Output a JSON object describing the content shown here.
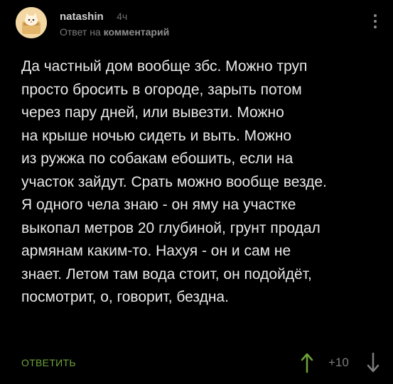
{
  "comment": {
    "author": "natashin",
    "time": "4ч",
    "reply_prefix": "Ответ на",
    "reply_link": "комментарий",
    "lines": [
      "Да частный дом вообще збс. Можно труп",
      "просто бросить в огороде, зарыть потом",
      "через пару дней, или вывезти. Можно",
      "на крыше ночью сидеть и выть. Можно",
      "из ружжа по собакам ебошить, если на",
      "участок зайдут. Срать можно вообще везде.",
      "Я одного чела знаю - он яму на участке",
      "выкопал метров 20 глубиной, грунт продал",
      "армянам каким-то. Нахуя - он и сам не",
      "знает. Летом там вода стоит, он подойдёт,",
      "посмотрит, о, говорит, бездна."
    ],
    "reply_button": "ОТВЕТИТЬ",
    "score": "+10"
  },
  "colors": {
    "background": "#000000",
    "accent_green": "#6ea23a",
    "muted": "#7d7d7d"
  },
  "icons": {
    "avatar": "cat-avatar",
    "menu": "more-vertical-icon",
    "upvote": "arrow-up-icon",
    "downvote": "arrow-down-icon"
  }
}
